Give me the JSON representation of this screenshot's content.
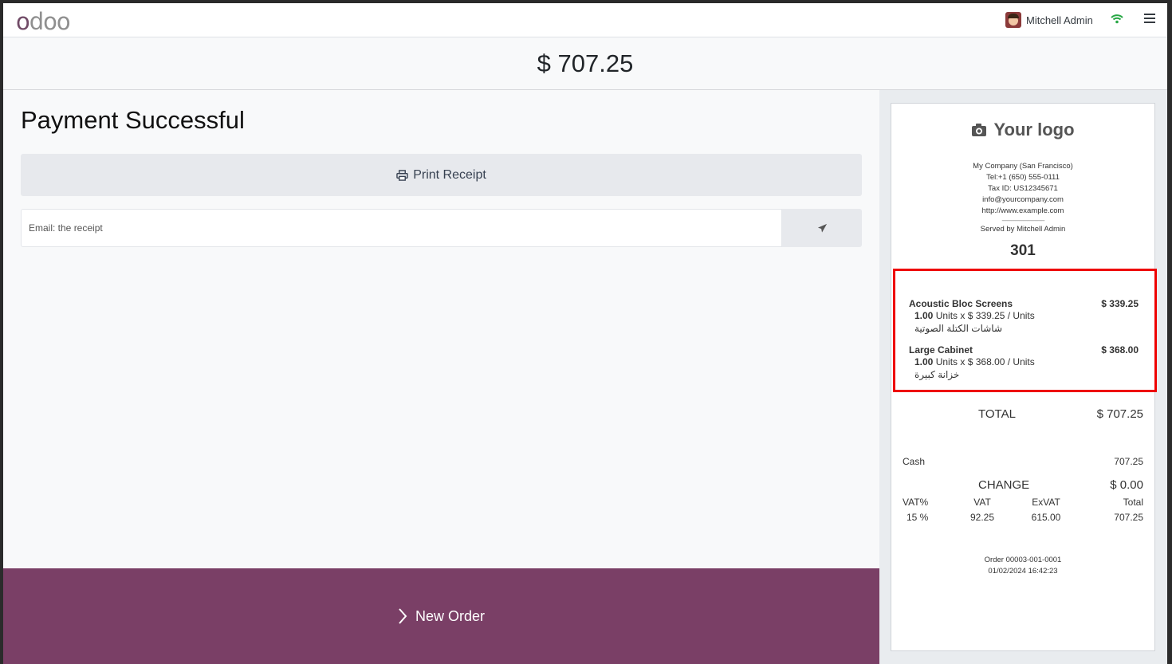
{
  "header": {
    "logo_text": "odoo",
    "user_name": "Mitchell Admin",
    "brand_color": "#714B67"
  },
  "order_total": "$ 707.25",
  "payment": {
    "title": "Payment Successful",
    "print_label": "Print Receipt",
    "email_placeholder": "Email: the receipt",
    "new_order_label": "New Order",
    "new_order_color": "#7a3f66"
  },
  "receipt": {
    "logo_text": "Your logo",
    "company": {
      "name": "My Company (San Francisco)",
      "tel": "Tel:+1 (650) 555-0111",
      "tax_id": "Tax ID: US12345671",
      "email": "info@yourcompany.com",
      "website": "http://www.example.com",
      "separator": "--------------------------------",
      "served_by": "Served by Mitchell Admin"
    },
    "tracking_number": "301",
    "lines": [
      {
        "name": "Acoustic Bloc Screens",
        "price": "$ 339.25",
        "qty": "1.00",
        "detail": "Units x $ 339.25 / Units",
        "arabic": "شاشات الكتلة الصوتية"
      },
      {
        "name": "Large Cabinet",
        "price": "$ 368.00",
        "qty": "1.00",
        "detail": "Units x $ 368.00 / Units",
        "arabic": "خزانة كبيرة"
      }
    ],
    "total_label": "TOTAL",
    "total_value": "$ 707.25",
    "cash_label": "Cash",
    "cash_value": "707.25",
    "change_label": "CHANGE",
    "change_value": "$ 0.00",
    "tax_headers": [
      "VAT%",
      "VAT",
      "ExVAT",
      "Total"
    ],
    "tax_row": [
      "15 %",
      "92.25",
      "615.00",
      "707.25"
    ],
    "order_ref": "Order 00003-001-0001",
    "order_date": "01/02/2024 16:42:23"
  }
}
